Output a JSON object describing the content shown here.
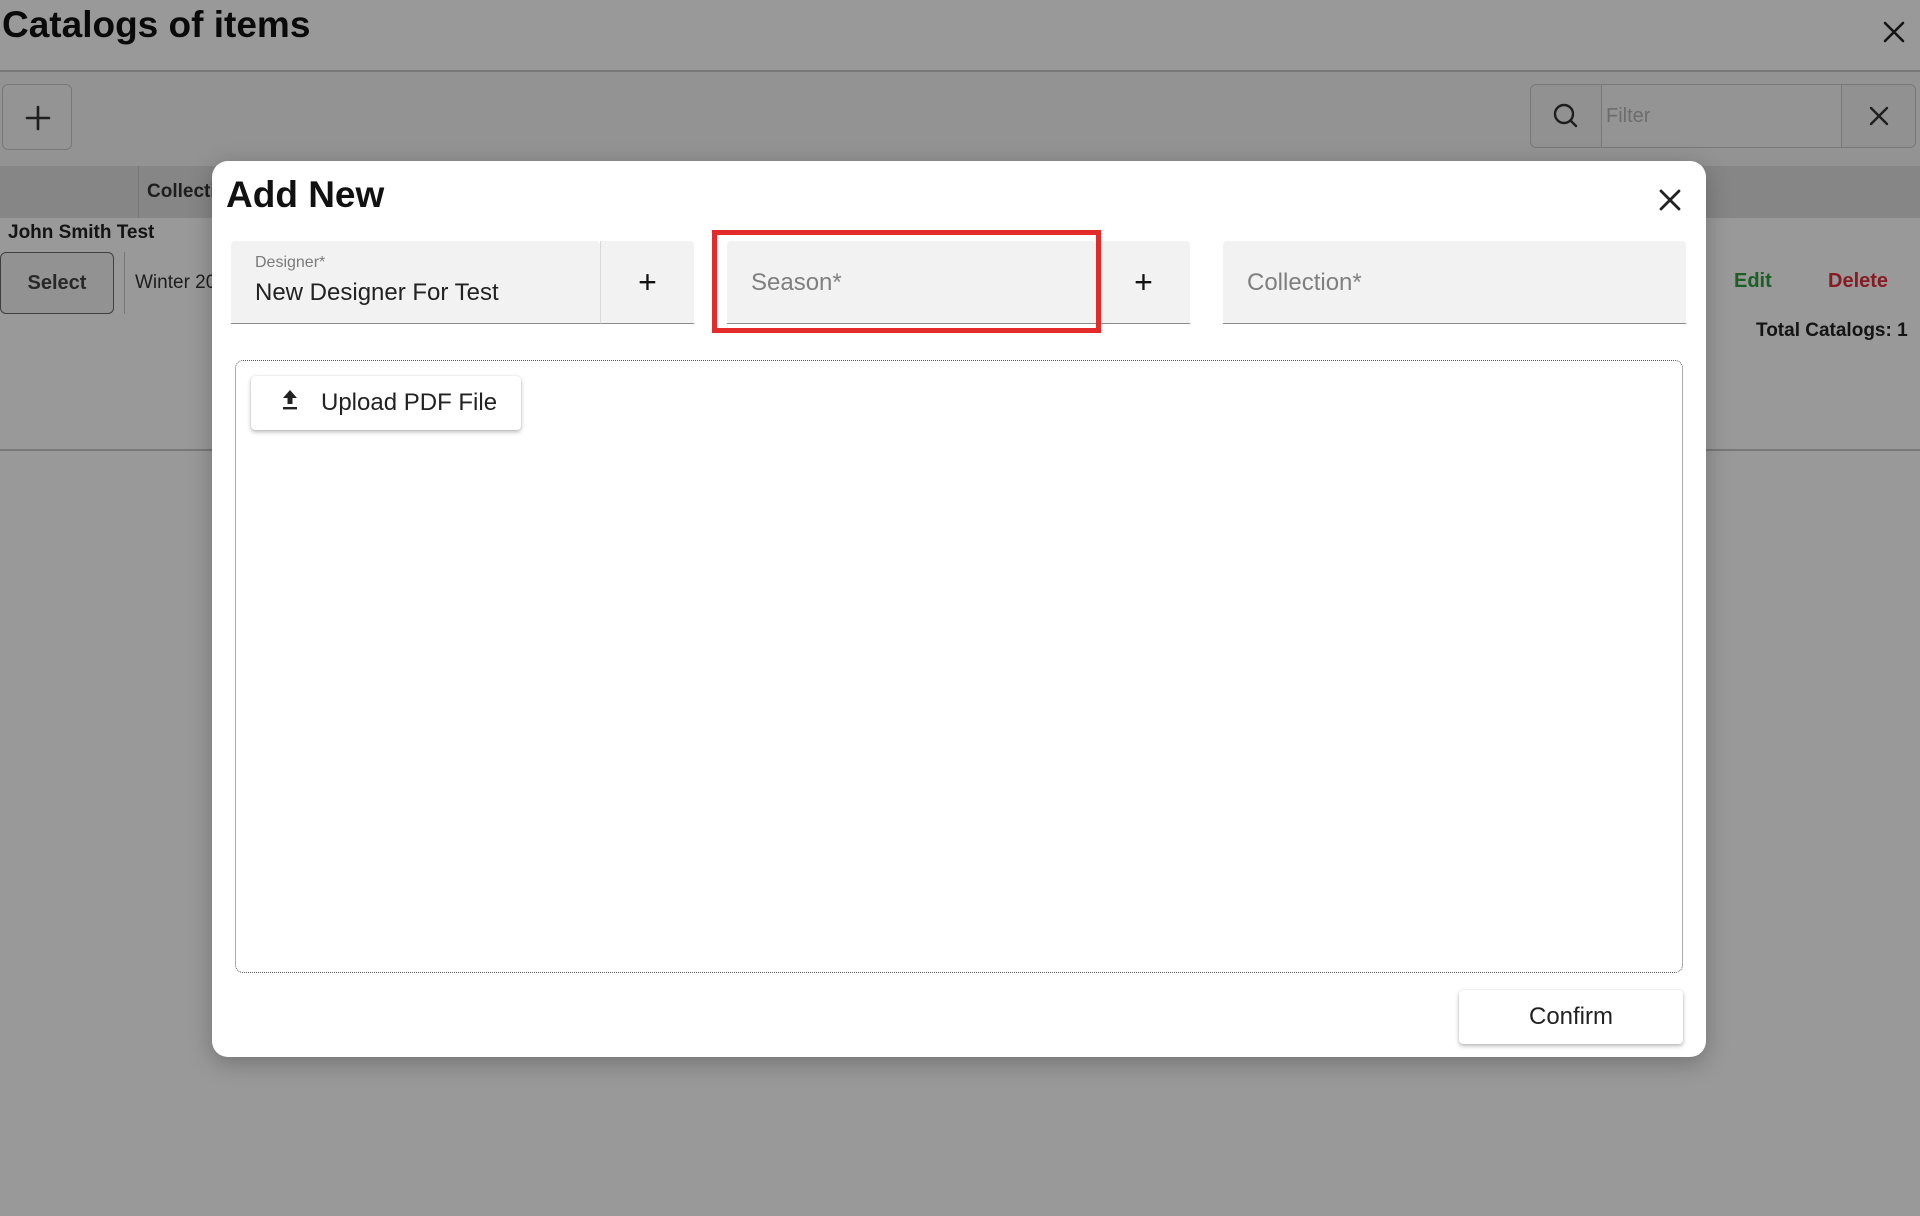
{
  "page": {
    "title": "Catalogs of items",
    "close_icon": "close-icon",
    "toolbar": {
      "add_icon": "plus-icon",
      "search_icon": "search-icon",
      "filter_placeholder": "Filter",
      "clear_icon": "close-icon"
    },
    "table": {
      "columns": [
        "",
        "Collection"
      ],
      "visible_column_label": "Collectic",
      "group_name": "John Smith Test",
      "rows": [
        {
          "select_label": "Select",
          "collection": "Winter 20",
          "edit_label": "Edit",
          "delete_label": "Delete"
        }
      ],
      "total_label": "Total Catalogs: 1"
    },
    "colors": {
      "edit": "#2e9e3b",
      "delete": "#e0303b"
    }
  },
  "modal": {
    "title": "Add New",
    "close_icon": "close-icon",
    "designer": {
      "label": "Designer*",
      "value": "New Designer For Test",
      "add_label": "+"
    },
    "season": {
      "placeholder": "Season*",
      "add_label": "+",
      "highlighted": true
    },
    "collection": {
      "placeholder": "Collection*"
    },
    "upload": {
      "label": "Upload PDF File",
      "icon": "upload-icon"
    },
    "confirm_label": "Confirm",
    "highlight_color": "#e32b2b"
  }
}
